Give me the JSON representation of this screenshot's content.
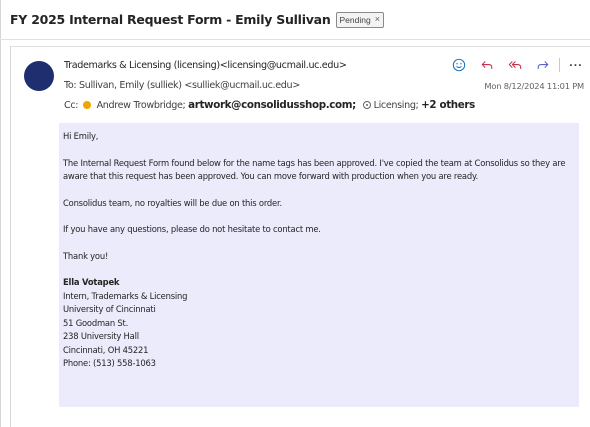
{
  "subject": "FY 2025 Internal Request Form - Emily Sullivan",
  "status_chip": {
    "label": "Pending",
    "close": "×"
  },
  "message": {
    "from": "Trademarks & Licensing (licensing)<licensing@ucmail.uc.edu>",
    "to_label": "To:",
    "to": "Sullivan, Emily (sulliek) <sulliek@ucmail.uc.edu>",
    "cc_label": "Cc:",
    "cc": [
      {
        "name": "Andrew Trowbridge;",
        "style": "presence"
      },
      {
        "name": "artwork@consolidusshop.com;",
        "style": "bold"
      },
      {
        "name": "Licensing;",
        "style": "group"
      },
      {
        "name": "+2 others",
        "style": "more"
      }
    ],
    "date": "Mon 8/12/2024 11:01 PM",
    "more_label": "···",
    "body": {
      "greeting": "Hi Emily,",
      "para1": "The Internal Request Form found below for the name tags has been approved. I've copied the team at Consolidus so they are aware that this request has been approved. You can move forward with production when you are ready.",
      "para2": "Consolidus team, no royalties will be due on this order.",
      "para3": "If you have any questions, please do not hesitate to contact me.",
      "closing": "Thank you!",
      "signature": {
        "name": "Ella Votapek",
        "title": "Intern, Trademarks & Licensing",
        "org": "University of Cincinnati",
        "address1": "51 Goodman St.",
        "address2": "238 University Hall",
        "city": "Cincinnati, OH 45221",
        "phone": "Phone: (513) 558-1063"
      }
    }
  },
  "icons": {
    "emoji": "smiley-icon",
    "reply": "reply-icon",
    "reply_all": "reply-all-icon",
    "forward": "forward-icon",
    "more": "more-icon"
  },
  "colors": {
    "accent": "#0f6cbd",
    "avatar": "#1e2e6e",
    "body_highlight": "#ebebfb",
    "presence_away": "#f0a500"
  }
}
